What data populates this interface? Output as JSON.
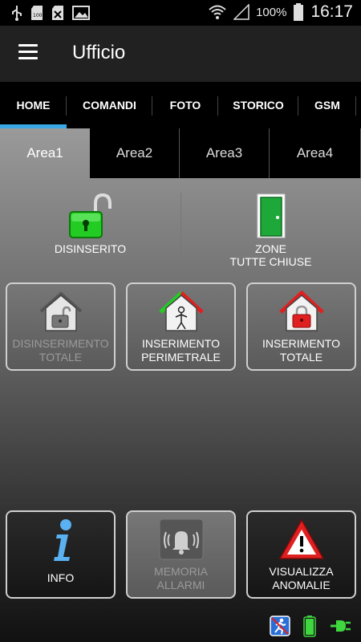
{
  "statusbar": {
    "battery_percent": "100%",
    "time": "16:17",
    "icons": [
      "usb-icon",
      "sd-card-icon",
      "no-sim-icon",
      "image-icon",
      "wifi-icon",
      "signal-icon",
      "battery-icon"
    ]
  },
  "appbar": {
    "title": "Ufficio",
    "menu_icon": "hamburger-menu-icon"
  },
  "tabs": [
    "HOME",
    "COMANDI",
    "FOTO",
    "STORICO",
    "GSM"
  ],
  "active_tab": "HOME",
  "areas": [
    "Area1",
    "Area2",
    "Area3",
    "Area4"
  ],
  "active_area": "Area1",
  "status": {
    "arm_state": "DISINSERITO",
    "zones_line1": "ZONE",
    "zones_line2": "TUTTE CHIUSE"
  },
  "actions": {
    "disarm_line1": "DISINSERIMENTO",
    "disarm_line2": "TOTALE",
    "perimeter_line1": "INSERIMENTO",
    "perimeter_line2": "PERIMETRALE",
    "total_line1": "INSERIMENTO",
    "total_line2": "TOTALE"
  },
  "bottom": {
    "info_label": "INFO",
    "memory_line1": "MEMORIA",
    "memory_line2": "ALLARMI",
    "anomalies_line1": "VISUALIZZA",
    "anomalies_line2": "ANOMALIE"
  },
  "colors": {
    "accent": "#3aa8e6",
    "unlocked_green": "#22cc22",
    "locked_red": "#e02020",
    "door_green": "#1fa83a"
  }
}
